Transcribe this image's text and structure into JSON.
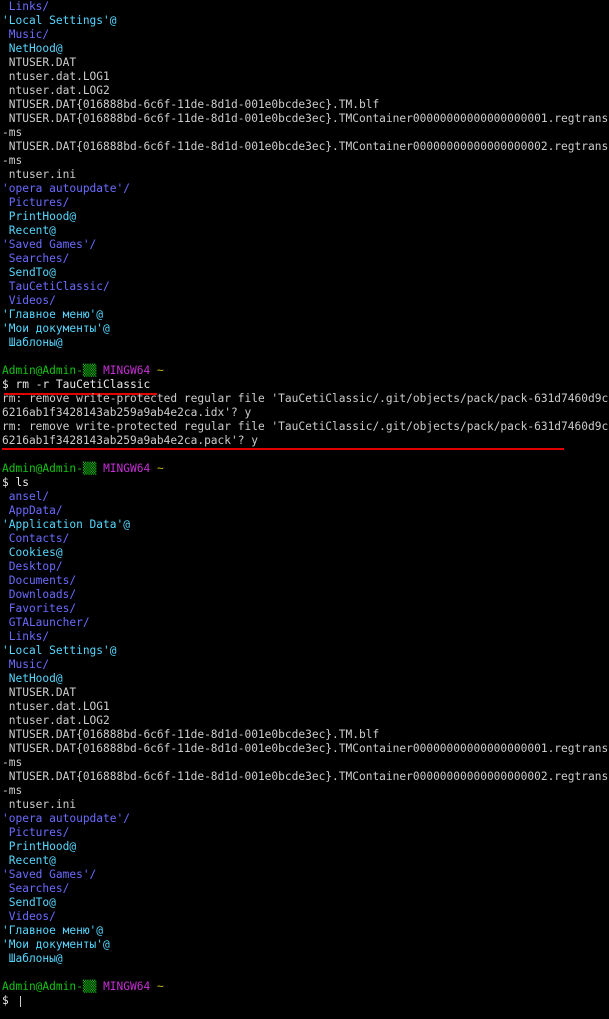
{
  "terminal": {
    "prompt_user": "Admin@Admin-",
    "prompt_host_glyph": "▒▒",
    "prompt_env": "MINGW64",
    "prompt_path": "~",
    "prompt_symbol": "$",
    "colors": {
      "background": "#000000",
      "directory": "#6b6bff",
      "symlink": "#55d7ff",
      "file": "#cccccc",
      "user": "#11c411",
      "env": "#c530d4",
      "path": "#c7b916",
      "annotation_underline": "#e10000"
    },
    "top_listing": [
      {
        "text": " Links/",
        "kind": "dir"
      },
      {
        "text": "'Local Settings'@",
        "kind": "sym"
      },
      {
        "text": " Music/",
        "kind": "dir"
      },
      {
        "text": " NetHood@",
        "kind": "sym"
      },
      {
        "text": " NTUSER.DAT",
        "kind": "file"
      },
      {
        "text": " ntuser.dat.LOG1",
        "kind": "file"
      },
      {
        "text": " ntuser.dat.LOG2",
        "kind": "file"
      },
      {
        "text": " NTUSER.DAT{016888bd-6c6f-11de-8d1d-001e0bcde3ec}.TM.blf",
        "kind": "file"
      },
      {
        "text": " NTUSER.DAT{016888bd-6c6f-11de-8d1d-001e0bcde3ec}.TMContainer00000000000000000001.regtrans-ms",
        "kind": "file"
      },
      {
        "text": " NTUSER.DAT{016888bd-6c6f-11de-8d1d-001e0bcde3ec}.TMContainer00000000000000000002.regtrans-ms",
        "kind": "file"
      },
      {
        "text": " ntuser.ini",
        "kind": "file"
      },
      {
        "text": "'opera autoupdate'/",
        "kind": "dir"
      },
      {
        "text": " Pictures/",
        "kind": "dir"
      },
      {
        "text": " PrintHood@",
        "kind": "sym"
      },
      {
        "text": " Recent@",
        "kind": "sym"
      },
      {
        "text": "'Saved Games'/",
        "kind": "dir"
      },
      {
        "text": " Searches/",
        "kind": "dir"
      },
      {
        "text": " SendTo@",
        "kind": "sym"
      },
      {
        "text": " TauCetiClassic/",
        "kind": "dir"
      },
      {
        "text": " Videos/",
        "kind": "dir"
      },
      {
        "text": "'Главное меню'@",
        "kind": "sym"
      },
      {
        "text": "'Мои документы'@",
        "kind": "sym"
      },
      {
        "text": " Шаблоны@",
        "kind": "sym"
      }
    ],
    "rm_command": "rm -r TauCetiClassic",
    "rm_output": [
      "rm: remove write-protected regular file 'TauCetiClassic/.git/objects/pack/pack-631d7460d9c6216ab1f3428143ab259a9ab4e2ca.idx'? y",
      "rm: remove write-protected regular file 'TauCetiClassic/.git/objects/pack/pack-631d7460d9c6216ab1f3428143ab259a9ab4e2ca.pack'? y"
    ],
    "ls_command": "ls",
    "ls_listing": [
      {
        "text": " ansel/",
        "kind": "dir"
      },
      {
        "text": " AppData/",
        "kind": "dir"
      },
      {
        "text": "'Application Data'@",
        "kind": "sym"
      },
      {
        "text": " Contacts/",
        "kind": "dir"
      },
      {
        "text": " Cookies@",
        "kind": "sym"
      },
      {
        "text": " Desktop/",
        "kind": "dir"
      },
      {
        "text": " Documents/",
        "kind": "dir"
      },
      {
        "text": " Downloads/",
        "kind": "dir"
      },
      {
        "text": " Favorites/",
        "kind": "dir"
      },
      {
        "text": " GTALauncher/",
        "kind": "dir"
      },
      {
        "text": " Links/",
        "kind": "dir"
      },
      {
        "text": "'Local Settings'@",
        "kind": "sym"
      },
      {
        "text": " Music/",
        "kind": "dir"
      },
      {
        "text": " NetHood@",
        "kind": "sym"
      },
      {
        "text": " NTUSER.DAT",
        "kind": "file"
      },
      {
        "text": " ntuser.dat.LOG1",
        "kind": "file"
      },
      {
        "text": " ntuser.dat.LOG2",
        "kind": "file"
      },
      {
        "text": " NTUSER.DAT{016888bd-6c6f-11de-8d1d-001e0bcde3ec}.TM.blf",
        "kind": "file"
      },
      {
        "text": " NTUSER.DAT{016888bd-6c6f-11de-8d1d-001e0bcde3ec}.TMContainer00000000000000000001.regtrans-ms",
        "kind": "file"
      },
      {
        "text": " NTUSER.DAT{016888bd-6c6f-11de-8d1d-001e0bcde3ec}.TMContainer00000000000000000002.regtrans-ms",
        "kind": "file"
      },
      {
        "text": " ntuser.ini",
        "kind": "file"
      },
      {
        "text": "'opera autoupdate'/",
        "kind": "dir"
      },
      {
        "text": " Pictures/",
        "kind": "dir"
      },
      {
        "text": " PrintHood@",
        "kind": "sym"
      },
      {
        "text": " Recent@",
        "kind": "sym"
      },
      {
        "text": "'Saved Games'/",
        "kind": "dir"
      },
      {
        "text": " Searches/",
        "kind": "dir"
      },
      {
        "text": " SendTo@",
        "kind": "sym"
      },
      {
        "text": " Videos/",
        "kind": "dir"
      },
      {
        "text": "'Главное меню'@",
        "kind": "sym"
      },
      {
        "text": "'Мои документы'@",
        "kind": "sym"
      },
      {
        "text": " Шаблоны@",
        "kind": "sym"
      }
    ]
  }
}
